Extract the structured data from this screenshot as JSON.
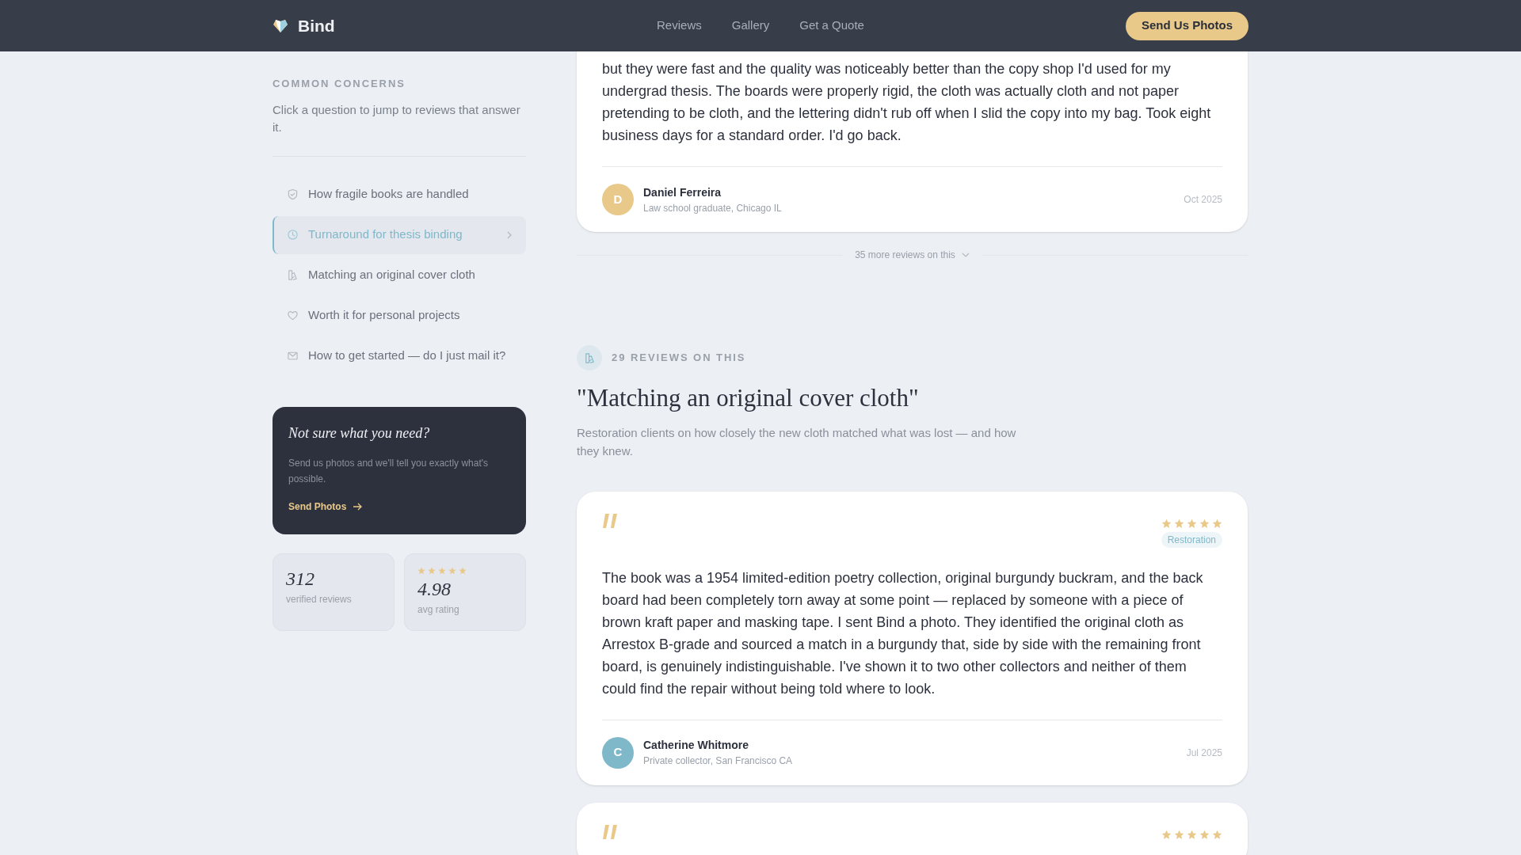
{
  "header": {
    "brand": "Bind",
    "nav": [
      "Reviews",
      "Gallery",
      "Get a Quote"
    ],
    "cta": "Send Us Photos"
  },
  "sidebar": {
    "eyebrow": "COMMON CONCERNS",
    "intro": "Click a question to jump to reviews that answer it.",
    "concerns": [
      {
        "kind": "shield",
        "label": "How fragile books are handled",
        "selected": false
      },
      {
        "kind": "clock",
        "label": "Turnaround for thesis binding",
        "selected": true
      },
      {
        "kind": "book",
        "label": "Matching an original cover cloth",
        "selected": false
      },
      {
        "kind": "heart",
        "label": "Worth it for personal projects",
        "selected": false
      },
      {
        "kind": "mail",
        "label": "How to get started — do I just mail it?",
        "selected": false
      }
    ],
    "promo": {
      "title": "Not sure what you need?",
      "text": "Send us photos and we'll tell you exactly what's possible.",
      "link": "Send Photos"
    },
    "stats": [
      {
        "value": "312",
        "label": "verified reviews"
      },
      {
        "stars": 5,
        "value": "4.98",
        "label": "avg rating"
      }
    ]
  },
  "top_review": {
    "text": "but they were fast and the quality was noticeably better than the copy shop I'd used for my undergrad thesis. The boards were properly rigid, the cloth was actually cloth and not paper pretending to be cloth, and the lettering didn't rub off when I slid the copy into my bag. Took eight business days for a standard order. I'd go back.",
    "initial": "D",
    "color": "#e8c98a",
    "author": "Daniel Ferreira",
    "role": "Law school graduate, Chicago IL",
    "date": "Oct 2025"
  },
  "more_link": "35 more reviews on this",
  "section": {
    "count": "29 REVIEWS ON THIS",
    "title": "\"Matching an original cover cloth\"",
    "description": "Restoration clients on how closely the new cloth matched what was lost — and how they knew.",
    "reviews": [
      {
        "stars": 5,
        "tag": "Restoration",
        "text": "The book was a 1954 limited-edition poetry collection, original burgundy buckram, and the back board had been completely torn away at some point — replaced by someone with a piece of brown kraft paper and masking tape. I sent Bind a photo. They identified the original cloth as Arrestox B-grade and sourced a match in a burgundy that, side by side with the remaining front board, is genuinely indistinguishable. I've shown it to two other collectors and neither of them could find the repair without being told where to look.",
        "initial": "C",
        "color": "#7fb8c9",
        "author": "Catherine Whitmore",
        "role": "Private collector, San Francisco CA",
        "date": "Jul 2025"
      },
      {
        "stars": 5
      }
    ]
  }
}
